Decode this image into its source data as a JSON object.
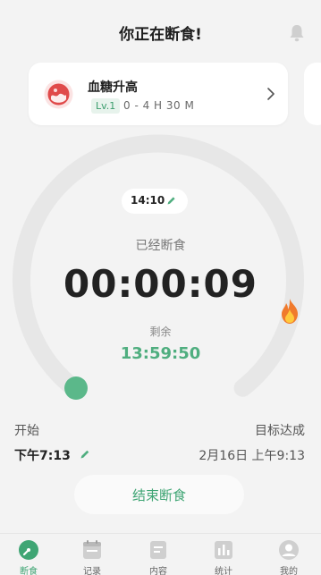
{
  "header": {
    "title": "你正在断食!"
  },
  "stage": {
    "title": "血糖升高",
    "level": "Lv.1",
    "range": "0 - 4 H 30 M"
  },
  "timer": {
    "start_time_pill": "14:10",
    "elapsed_label": "已经断食",
    "elapsed_value": "00:00:09",
    "remaining_label": "剩余",
    "remaining_value": "13:59:50",
    "progress_fraction": 0.0
  },
  "schedule": {
    "start_label": "开始",
    "start_value": "下午7:13",
    "goal_label": "目标达成",
    "goal_value": "2月16日 上午9:13"
  },
  "end_button": {
    "label": "结束断食"
  },
  "tabs": [
    {
      "label": "断食",
      "icon": "fasting-icon",
      "active": true
    },
    {
      "label": "记录",
      "icon": "calendar-icon",
      "active": false
    },
    {
      "label": "内容",
      "icon": "document-icon",
      "active": false
    },
    {
      "label": "统计",
      "icon": "bar-chart-icon",
      "active": false
    },
    {
      "label": "我的",
      "icon": "profile-icon",
      "active": false
    }
  ],
  "colors": {
    "accent": "#4fae7f",
    "ring_track": "#e7e7e7",
    "stage_red": "#e04a4a"
  }
}
